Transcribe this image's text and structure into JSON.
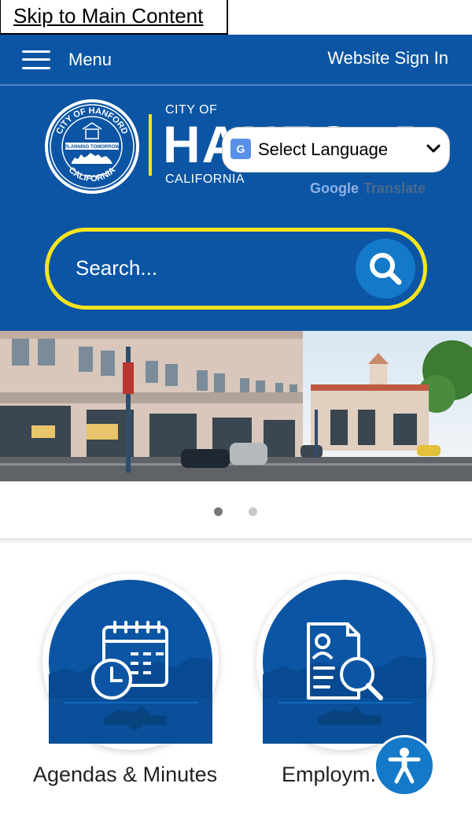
{
  "skip_link": "Skip to Main Content",
  "topbar": {
    "menu_label": "Menu",
    "sign_in": "Website Sign In"
  },
  "header": {
    "city_of": "CITY OF",
    "city_name": "HANFORD",
    "state": "CALIFORNIA",
    "seal_text_top": "CITY OF HANFORD",
    "seal_text_band": "PLANNING TOMORROW",
    "seal_text_bottom": "CALIFORNIA"
  },
  "translate": {
    "selected_language": "Select Language",
    "powered_by": {
      "brand": "Google",
      "product": "Translate"
    }
  },
  "search": {
    "placeholder": "Search..."
  },
  "carousel": {
    "slide_count": 2,
    "active_index": 0
  },
  "quick_links": [
    {
      "label": "Agendas & Minutes",
      "icon": "calendar-clock-icon"
    },
    {
      "label": "Employm...",
      "icon": "job-search-icon"
    }
  ],
  "colors": {
    "brand_blue": "#0b55a4",
    "accent_yellow": "#f7e41d",
    "button_blue": "#1479c8"
  }
}
